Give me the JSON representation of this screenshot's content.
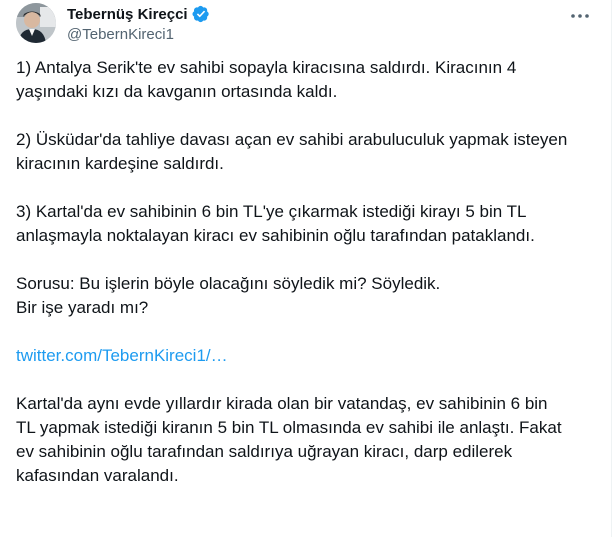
{
  "author": {
    "display_name": "Tebernüş Kireçci",
    "handle": "@TebernKireci1",
    "verified": true
  },
  "icons": {
    "verified": "verified-badge-icon",
    "more": "more-options-icon",
    "avatar": "profile-avatar"
  },
  "colors": {
    "text": "#0f1419",
    "secondary": "#536471",
    "link": "#1d9bf0",
    "verified": "#1d9bf0"
  },
  "tweet": {
    "paragraphs": [
      [
        "1) Antalya Serik'te  ev sahibi sopayla kiracısına saldırdı. Kiracının 4",
        "yaşındaki kızı da kavganın ortasında kaldı."
      ],
      [
        "2) Üsküdar'da tahliye davası açan ev sahibi arabuluculuk yapmak isteyen",
        "kiracının kardeşine saldırdı."
      ],
      [
        "3) Kartal'da ev sahibinin 6 bin TL'ye çıkarmak istediği kirayı 5 bin TL",
        "anlaşmayla noktalayan kiracı ev sahibinin oğlu tarafından pataklandı."
      ],
      [
        "Sorusu: Bu işlerin böyle olacağını söyledik mi? Söyledik.",
        "Bir işe yaradı mı?"
      ]
    ],
    "link": "twitter.com/TebernKireci1/…",
    "quote_paragraph": [
      "Kartal'da aynı evde yıllardır kirada olan bir vatandaş, ev sahibinin 6 bin",
      "TL yapmak istediği kiranın 5 bin TL olmasında ev sahibi ile anlaştı. Fakat",
      "ev sahibinin oğlu tarafından saldırıya uğrayan kiracı, darp edilerek",
      "kafasından varalandı."
    ]
  }
}
